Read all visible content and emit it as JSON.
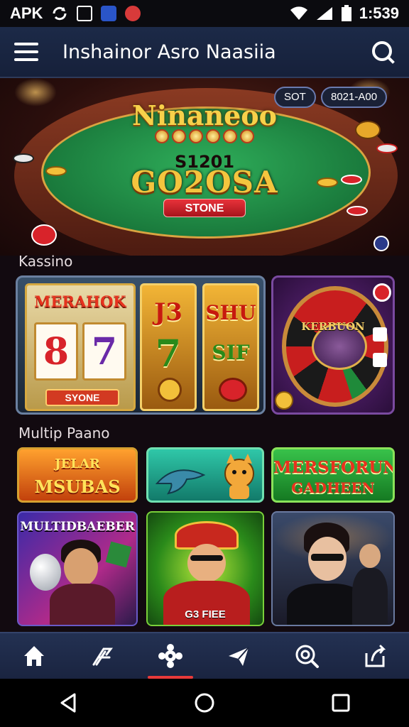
{
  "status_bar": {
    "left_text": "APK",
    "time": "1:539",
    "icons": [
      "sync-icon",
      "sim-card-icon",
      "app-notification-icon",
      "alert-notification-icon",
      "wifi-icon",
      "signal-icon",
      "battery-icon"
    ]
  },
  "app_bar": {
    "title": "Inshainor Asro Naasiia",
    "menu_icon": "menu-icon",
    "search_icon": "search-icon"
  },
  "hero": {
    "title": "Ninaneoo",
    "subtitle": "S1201",
    "amount": "GO2OSA",
    "button_label": "STONE",
    "pill_left": "SOT",
    "pill_right": "8021-A00"
  },
  "sections": {
    "casino_label": "Kassino",
    "multiplayer_label": "Multip Paano"
  },
  "slots_card": {
    "title": "MERAHOK",
    "reel_1": "8",
    "reel_2": "7",
    "button_label": "SYONE",
    "mini_1_top": "J3",
    "mini_1_mid": "7",
    "mini_2_top": "SHU",
    "mini_2_mid": "SIF"
  },
  "roulette_card": {
    "label": "KERBUON"
  },
  "tiles": {
    "orange": {
      "line_1": "JELAR",
      "line_2": "MSUBAS"
    },
    "green": {
      "line_1": "MERSFORUN",
      "line_2": "GADHEEN"
    }
  },
  "game_cards": {
    "card_1_title": "MULTIDBAEBER",
    "card_2_bottom": "G3 FIEE"
  },
  "bottom_nav": {
    "items": [
      "home-icon",
      "slots-icon",
      "games-icon",
      "send-icon",
      "settings-icon",
      "share-icon"
    ],
    "active_index": 2
  },
  "system_nav": {
    "items": [
      "back-icon",
      "home-circle-icon",
      "recents-icon"
    ]
  },
  "colors": {
    "accent": "#e83a3a",
    "app_bar": "#1c2a48",
    "gold": "#f4c53e",
    "felt": "#1a7a3c"
  }
}
